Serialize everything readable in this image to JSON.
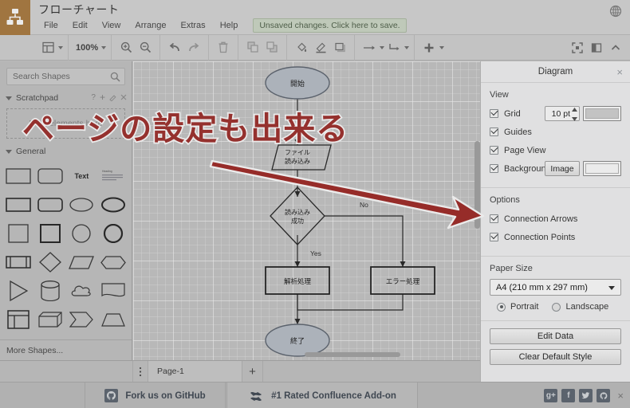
{
  "app": {
    "doc_title": "フローチャート",
    "logo_color": "#d07a12",
    "accent_red": "#e8221c"
  },
  "menubar": {
    "items": [
      "File",
      "Edit",
      "View",
      "Arrange",
      "Extras",
      "Help"
    ],
    "save_notice": "Unsaved changes. Click here to save.",
    "globe_icon": "globe-icon"
  },
  "toolbar": {
    "zoom_level": "100%",
    "buttons": [
      {
        "name": "view-layers-icon"
      },
      {
        "name": "zoom-in-icon"
      },
      {
        "name": "zoom-out-icon"
      },
      {
        "name": "undo-icon"
      },
      {
        "name": "redo-icon"
      },
      {
        "name": "delete-icon"
      },
      {
        "name": "to-front-icon"
      },
      {
        "name": "to-back-icon"
      },
      {
        "name": "fill-color-icon"
      },
      {
        "name": "line-color-icon"
      },
      {
        "name": "shadow-icon"
      },
      {
        "name": "arrow-style-icon"
      },
      {
        "name": "waypoint-style-icon"
      },
      {
        "name": "insert-icon"
      },
      {
        "name": "fullscreen-icon"
      },
      {
        "name": "format-panel-icon"
      },
      {
        "name": "collapse-icon"
      }
    ]
  },
  "sidebar": {
    "search_placeholder": "Search Shapes",
    "search_value": "",
    "scratchpad": {
      "label": "Scratchpad",
      "drop_hint": "Drag elements here",
      "actions": [
        "help-icon",
        "add-icon",
        "edit-icon",
        "close-icon"
      ]
    },
    "general": {
      "label": "General"
    },
    "shape_text_label": "Text",
    "more_shapes": "More Shapes..."
  },
  "canvas": {
    "nodes": [
      {
        "id": "start",
        "label": "開始",
        "shape": "ellipse"
      },
      {
        "id": "read",
        "label_line1": "ファイル",
        "label_line2": "読み込み",
        "shape": "parallelogram"
      },
      {
        "id": "check",
        "label_line1": "読み込み",
        "label_line2": "成功",
        "shape": "diamond"
      },
      {
        "id": "parse",
        "label": "解析処理",
        "shape": "rect"
      },
      {
        "id": "error",
        "label": "エラー処理",
        "shape": "rect"
      },
      {
        "id": "end",
        "label": "終了",
        "shape": "ellipse"
      }
    ],
    "edge_labels": {
      "yes": "Yes",
      "no": "No"
    },
    "node_fill": "#b6c2d2",
    "node_stroke": "#5d6b80"
  },
  "annotation": {
    "text": "ページの設定も出来る",
    "arrow_color": "#ee1c16"
  },
  "pagebar": {
    "tab_label": "Page-1",
    "add_label": "+",
    "menu_icon": "kebab-menu-icon"
  },
  "format_panel": {
    "title": "Diagram",
    "close_icon": "close-icon",
    "view": {
      "heading": "View",
      "grid": {
        "label": "Grid",
        "checked": true,
        "size": "10 pt",
        "color": "#d4d4d4"
      },
      "guides": {
        "label": "Guides",
        "checked": true
      },
      "page_view": {
        "label": "Page View",
        "checked": true
      },
      "background": {
        "label": "Background",
        "checked": true,
        "image_button": "Image",
        "color": "#ffffff"
      }
    },
    "options": {
      "heading": "Options",
      "connection_arrows": {
        "label": "Connection Arrows",
        "checked": true
      },
      "connection_points": {
        "label": "Connection Points",
        "checked": true
      }
    },
    "paper": {
      "heading": "Paper Size",
      "selected": "A4 (210 mm x 297 mm)",
      "portrait": {
        "label": "Portrait",
        "selected": true
      },
      "landscape": {
        "label": "Landscape",
        "selected": false
      }
    },
    "actions": {
      "edit_data": "Edit Data",
      "clear_default_style": "Clear Default Style"
    }
  },
  "footer": {
    "ad_github": "Fork us on GitHub",
    "ad_confluence": "#1 Rated Confluence Add-on",
    "social": [
      "google-plus-icon",
      "facebook-icon",
      "twitter-icon",
      "github-icon"
    ],
    "close_icon": "×"
  }
}
